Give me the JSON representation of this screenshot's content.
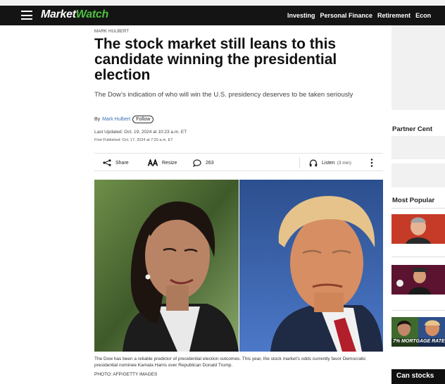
{
  "nav": {
    "logo_market": "Market",
    "logo_watch": "Watch",
    "links": [
      "Investing",
      "Personal Finance",
      "Retirement",
      "Econ"
    ]
  },
  "article": {
    "kicker": "MARK HULBERT",
    "headline": "The stock market still leans to this candidate winning the presidential election",
    "dek": "The Dow’s indication of who will win the U.S. presidency deserves to be taken seriously",
    "by_prefix": "By",
    "author": "Mark Hulbert",
    "follow_label": "Follow",
    "last_updated": "Last Updated: Oct. 19, 2024 at 10:23 a.m. ET",
    "first_published": "First Published: Oct. 17, 2024 at 7:20 a.m. ET",
    "caption": "The Dow has been a reliable predictor of presidential election outcomes. This year, the stock market’s odds currently favor Democratic presidential nominee Kamala Harris over Republican Donald Trump.",
    "credit": "PHOTO: AFP/GETTY IMAGES"
  },
  "toolbar": {
    "share_label": "Share",
    "resize_label": "Resize",
    "comment_count": "263",
    "listen_label": "Listen",
    "listen_duration": "(3 min)"
  },
  "sidebar": {
    "partner_title": "Partner Cent",
    "most_popular_title": "Most Popular",
    "thumb3_overlay": "7% MORTGAGE RATES",
    "bottom_header": "Can stocks"
  },
  "colors": {
    "nav_bg": "#141414",
    "logo_accent": "#4ec13f",
    "author_link": "#3b6fb5"
  }
}
